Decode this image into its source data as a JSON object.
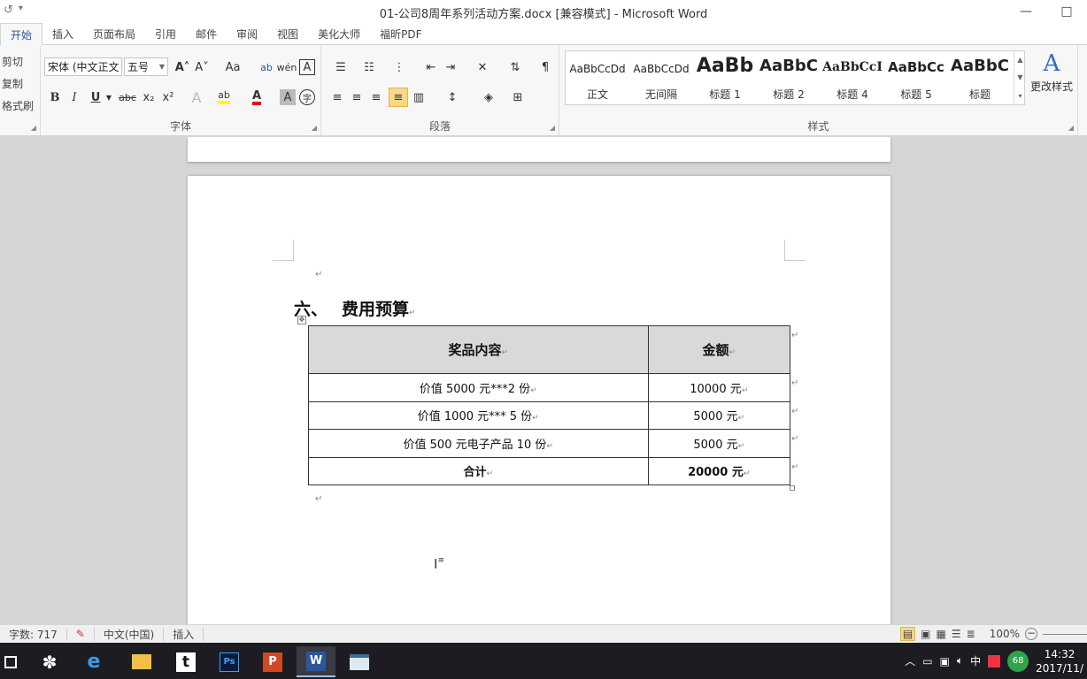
{
  "titlebar": {
    "title": "01-公司8周年系列活动方案.docx [兼容模式]  -  Microsoft Word",
    "minimize": "—",
    "restore": "□"
  },
  "tabs": [
    "开始",
    "插入",
    "页面布局",
    "引用",
    "邮件",
    "审阅",
    "视图",
    "美化大师",
    "福昕PDF"
  ],
  "ribbon": {
    "clipboard": {
      "cut": "剪切",
      "copy": "复制",
      "format_painter": "格式刷"
    },
    "font": {
      "font_name": "宋体 (中文正文",
      "font_size": "五号",
      "group_label": "字体",
      "grow": "A˄",
      "shrink": "A˅",
      "case": "Aa",
      "bold": "B",
      "italic": "I",
      "underline": "U",
      "strike": "abc",
      "sub": "x₂",
      "sup": "x²",
      "font_color_glyph": "A",
      "char_shade": "A",
      "enclose": "字"
    },
    "paragraph": {
      "group_label": "段落"
    },
    "styles": {
      "group_label": "样式",
      "items": [
        {
          "preview": "AaBbCcDd",
          "name": "正文"
        },
        {
          "preview": "AaBbCcDd",
          "name": "无间隔"
        },
        {
          "preview": "AaBb",
          "name": "标题 1"
        },
        {
          "preview": "AaBbC",
          "name": "标题 2"
        },
        {
          "preview": "AaBbCcI",
          "name": "标题 4"
        },
        {
          "preview": "AaBbCc",
          "name": "标题 5"
        },
        {
          "preview": "AaBbC",
          "name": "标题"
        }
      ],
      "change_styles": "更改样式"
    }
  },
  "document": {
    "heading_num": "六、",
    "heading_text": "费用预算",
    "table": {
      "headers": [
        "奖品内容",
        "金额"
      ],
      "rows": [
        [
          "价值 5000 元***2 份",
          "10000 元"
        ],
        [
          "价值 1000 元*** 5 份",
          "5000 元"
        ],
        [
          "价值 500 元电子产品 10 份",
          "5000 元"
        ],
        [
          "合计",
          "20000 元"
        ]
      ]
    },
    "para_mark": "↵"
  },
  "statusbar": {
    "word_count": "字数: 717",
    "language": "中文(中国)",
    "mode": "插入",
    "zoom": "100%"
  },
  "taskbar": {
    "badge": "68",
    "ime": "中",
    "time": "14:32",
    "date": "2017/11/"
  }
}
